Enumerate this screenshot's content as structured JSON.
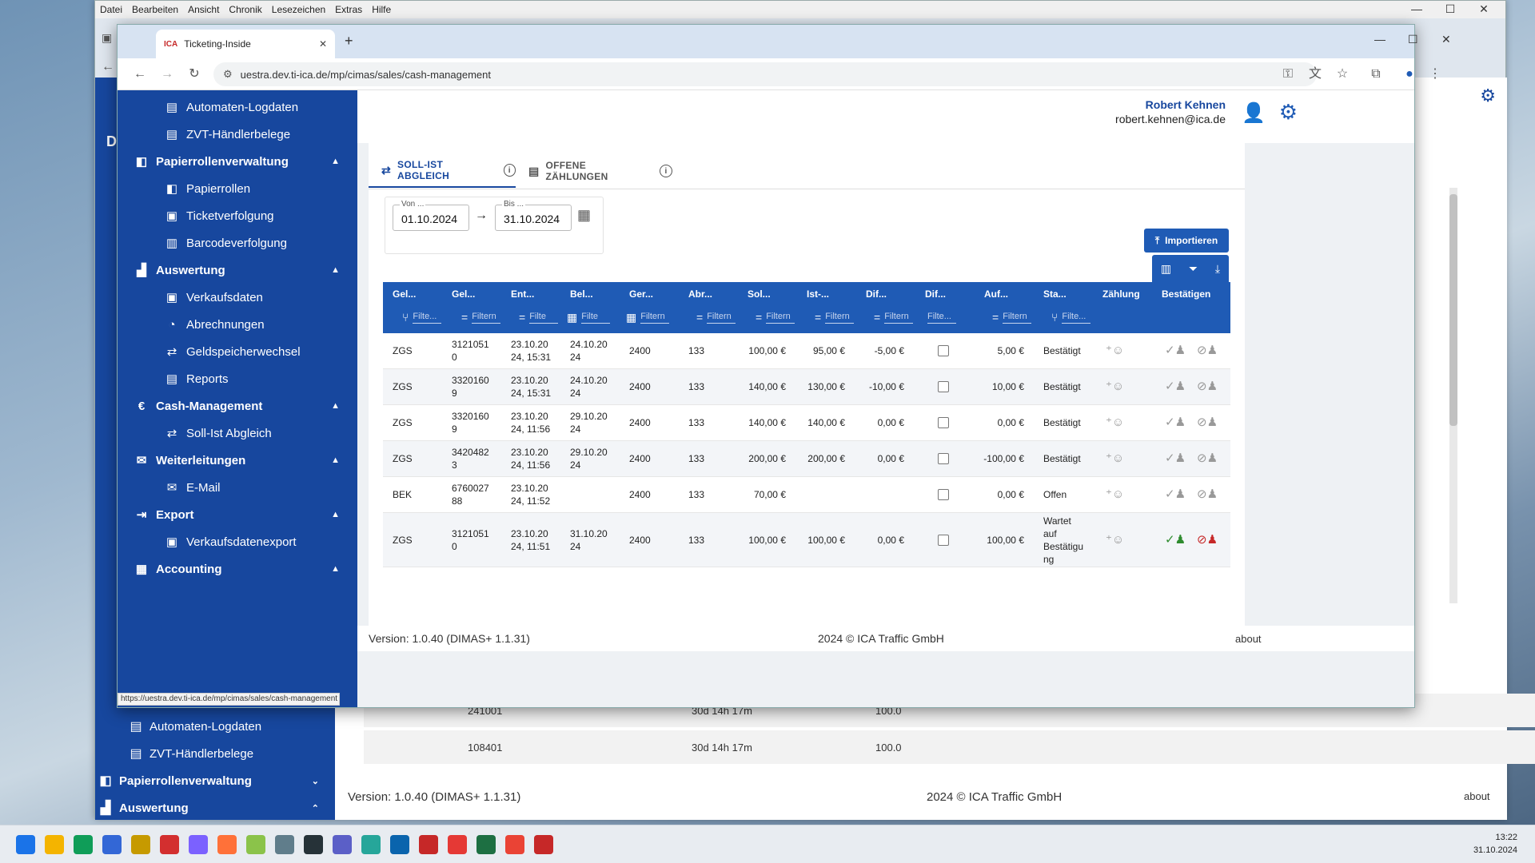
{
  "back_window": {
    "menu": [
      "Datei",
      "Bearbeiten",
      "Ansicht",
      "Chronik",
      "Lesezeichen",
      "Extras",
      "Hilfe"
    ],
    "sidebar": [
      {
        "label": "Automaten-Logdaten",
        "icon": "terminal-icon"
      },
      {
        "label": "ZVT-Händlerbelege",
        "icon": "receipt-icon"
      },
      {
        "label": "Papierrollenverwaltung",
        "icon": "paper-roll-icon"
      },
      {
        "label": "Auswertung",
        "icon": "chart-icon"
      }
    ],
    "rows": [
      {
        "id": "241001",
        "duration": "30d 14h 17m",
        "value": "100.0"
      },
      {
        "id": "108401",
        "duration": "30d 14h 17m",
        "value": "100.0"
      }
    ],
    "footer": {
      "version": "Version: 1.0.40 (DIMAS+ 1.1.31)",
      "copyright": "2024 © ICA Traffic GmbH",
      "about": "about"
    }
  },
  "browser": {
    "tab_title": "Ticketing-Inside",
    "url": "uestra.dev.ti-ica.de/mp/cimas/sales/cash-management",
    "status_url": "https://uestra.dev.ti-ica.de/mp/cimas/sales/cash-management"
  },
  "user": {
    "name": "Robert Kehnen",
    "email": "robert.kehnen@ica.de"
  },
  "sidebar": {
    "items": [
      {
        "label": "Automaten-Logdaten",
        "icon": "terminal-icon",
        "group": false
      },
      {
        "label": "ZVT-Händlerbelege",
        "icon": "receipt-icon",
        "group": false
      },
      {
        "label": "Papierrollenverwaltung",
        "icon": "paper-roll-icon",
        "group": true
      },
      {
        "label": "Papierrollen",
        "icon": "paper-roll-icon",
        "group": false
      },
      {
        "label": "Ticketverfolgung",
        "icon": "ticket-icon",
        "group": false
      },
      {
        "label": "Barcodeverfolgung",
        "icon": "barcode-icon",
        "group": false
      },
      {
        "label": "Auswertung",
        "icon": "chart-icon",
        "group": true
      },
      {
        "label": "Verkaufsdaten",
        "icon": "money-icon",
        "group": false
      },
      {
        "label": "Abrechnungen",
        "icon": "money-clock-icon",
        "group": false
      },
      {
        "label": "Geldspeicherwechsel",
        "icon": "exchange-icon",
        "group": false
      },
      {
        "label": "Reports",
        "icon": "document-icon",
        "group": false
      },
      {
        "label": "Cash-Management",
        "icon": "euro-icon",
        "group": true
      },
      {
        "label": "Soll-Ist Abgleich",
        "icon": "compare-icon",
        "group": false
      },
      {
        "label": "Weiterleitungen",
        "icon": "mail-icon",
        "group": true
      },
      {
        "label": "E-Mail",
        "icon": "email-icon",
        "group": false
      },
      {
        "label": "Export",
        "icon": "export-icon",
        "group": true
      },
      {
        "label": "Verkaufsdatenexport",
        "icon": "money-icon",
        "group": false
      },
      {
        "label": "Accounting",
        "icon": "bank-icon",
        "group": true
      }
    ]
  },
  "tabs": [
    {
      "label": "SOLL-IST ABGLEICH",
      "icon": "compare-icon"
    },
    {
      "label": "OFFENE ZÄHLUNGEN",
      "icon": "table-icon"
    }
  ],
  "date_range": {
    "from_label": "Von ...",
    "from": "01.10.2024",
    "to_label": "Bis ...",
    "to": "31.10.2024"
  },
  "import_label": "Importieren",
  "grid": {
    "columns": [
      "Gel...",
      "Gel...",
      "Ent...",
      "Bel...",
      "Ger...",
      "Abr...",
      "Sol...",
      "Ist-...",
      "Dif...",
      "Dif...",
      "Auf...",
      "Sta...",
      "Zählung",
      "Bestätigen"
    ],
    "filters": [
      "Filte...",
      "Filtern",
      "Filte",
      "Filte",
      "Filtern",
      "Filtern",
      "Filtern",
      "Filtern",
      "Filtern",
      "Filte...",
      "Filtern",
      "Filte..."
    ],
    "rows": [
      {
        "type": "ZGS",
        "id": "3121051\n0",
        "entry": "23.10.20\n24, 15:31",
        "beleg": "24.10.20\n24",
        "device": "2400",
        "abr": "133",
        "soll": "100,00 €",
        "ist": "95,00 €",
        "diff": "-5,00 €",
        "auf": "5,00 €",
        "status": "Bestätigt",
        "active": false
      },
      {
        "type": "ZGS",
        "id": "3320160\n9",
        "entry": "23.10.20\n24, 15:31",
        "beleg": "24.10.20\n24",
        "device": "2400",
        "abr": "133",
        "soll": "140,00 €",
        "ist": "130,00 €",
        "diff": "-10,00 €",
        "auf": "10,00 €",
        "status": "Bestätigt",
        "active": false
      },
      {
        "type": "ZGS",
        "id": "3320160\n9",
        "entry": "23.10.20\n24, 11:56",
        "beleg": "29.10.20\n24",
        "device": "2400",
        "abr": "133",
        "soll": "140,00 €",
        "ist": "140,00 €",
        "diff": "0,00 €",
        "auf": "0,00 €",
        "status": "Bestätigt",
        "active": false
      },
      {
        "type": "ZGS",
        "id": "3420482\n3",
        "entry": "23.10.20\n24, 11:56",
        "beleg": "29.10.20\n24",
        "device": "2400",
        "abr": "133",
        "soll": "200,00 €",
        "ist": "200,00 €",
        "diff": "0,00 €",
        "auf": "-100,00 €",
        "status": "Bestätigt",
        "active": false
      },
      {
        "type": "BEK",
        "id": "6760027\n88",
        "entry": "23.10.20\n24, 11:52",
        "beleg": "",
        "device": "2400",
        "abr": "133",
        "soll": "70,00 €",
        "ist": "",
        "diff": "",
        "auf": "0,00 €",
        "status": "Offen",
        "active": false
      },
      {
        "type": "ZGS",
        "id": "3121051\n0",
        "entry": "23.10.20\n24, 11:51",
        "beleg": "31.10.20\n24",
        "device": "2400",
        "abr": "133",
        "soll": "100,00 €",
        "ist": "100,00 €",
        "diff": "0,00 €",
        "auf": "100,00 €",
        "status": "Wartet\nauf\nBestätigu\nng",
        "active": true
      }
    ]
  },
  "footer": {
    "version": "Version: 1.0.40 (DIMAS+ 1.1.31)",
    "copyright": "2024 © ICA Traffic GmbH",
    "about": "about"
  },
  "taskbar": {
    "time": "13:22",
    "date": "31.10.2024",
    "apps": [
      {
        "name": "windows-start-icon",
        "color": "#1a73e8"
      },
      {
        "name": "file-explorer-icon",
        "color": "#f4b400"
      },
      {
        "name": "edge-icon",
        "color": "#0f9d58"
      },
      {
        "name": "store-icon",
        "color": "#3367d6"
      },
      {
        "name": "app-norton-icon",
        "color": "#c69a00"
      },
      {
        "name": "app-l-icon",
        "color": "#d32f2f"
      },
      {
        "name": "app-snip-icon",
        "color": "#7b61ff"
      },
      {
        "name": "firefox-icon",
        "color": "#ff7139"
      },
      {
        "name": "notepad-icon",
        "color": "#8bc34a"
      },
      {
        "name": "app-doc-icon",
        "color": "#607d8b"
      },
      {
        "name": "app-terminal-icon",
        "color": "#263238"
      },
      {
        "name": "teams-icon",
        "color": "#5b5fc7"
      },
      {
        "name": "app-diamond-icon",
        "color": "#26a69a"
      },
      {
        "name": "outlook-icon",
        "color": "#0a64ad"
      },
      {
        "name": "app-x1-icon",
        "color": "#c62828"
      },
      {
        "name": "app-pin-icon",
        "color": "#e53935"
      },
      {
        "name": "excel-icon",
        "color": "#1d6f42"
      },
      {
        "name": "chrome-icon",
        "color": "#ea4335"
      },
      {
        "name": "app-x2-icon",
        "color": "#c62828"
      }
    ]
  }
}
